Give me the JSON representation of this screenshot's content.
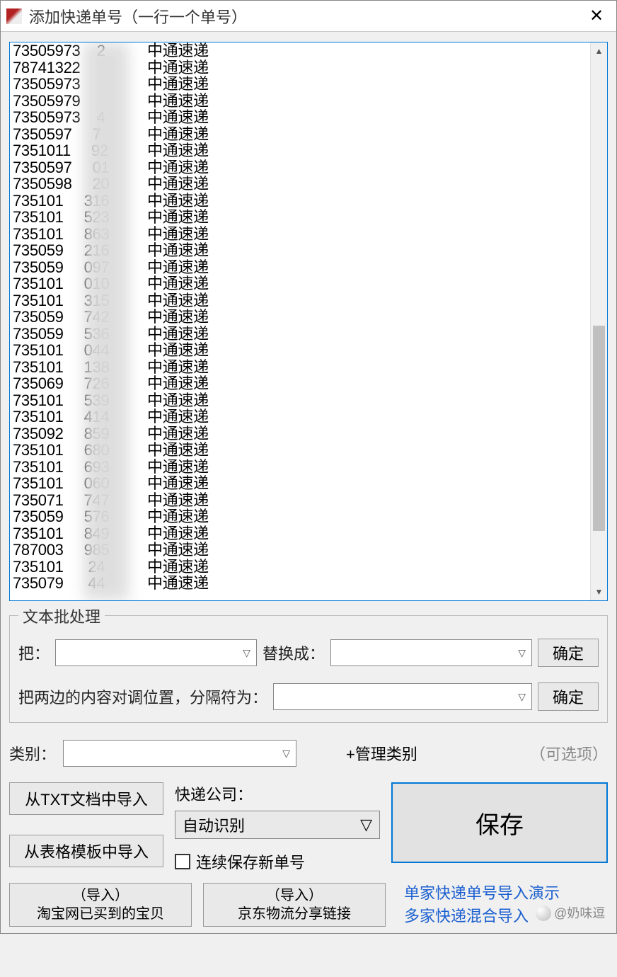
{
  "window": {
    "title": "添加快递单号（一行一个单号）"
  },
  "tracking_list": [
    {
      "num_left": "73505973",
      "num_right": "2",
      "carrier": "中通速递"
    },
    {
      "num_left": "78741322",
      "num_right": "",
      "carrier": "中通速递"
    },
    {
      "num_left": "73505973",
      "num_right": "",
      "carrier": "中通速递"
    },
    {
      "num_left": "73505979",
      "num_right": "",
      "carrier": "中通速递"
    },
    {
      "num_left": "73505973",
      "num_right": "4",
      "carrier": "中通速递"
    },
    {
      "num_left": "7350597",
      "num_right": "7",
      "carrier": "中通速递"
    },
    {
      "num_left": "7351011",
      "num_right": "92",
      "carrier": "中通速递"
    },
    {
      "num_left": "7350597",
      "num_right": "01",
      "carrier": "中通速递"
    },
    {
      "num_left": "7350598",
      "num_right": "20",
      "carrier": "中通速递"
    },
    {
      "num_left": "735101",
      "num_right": "316",
      "carrier": "中通速递"
    },
    {
      "num_left": "735101",
      "num_right": "523",
      "carrier": "中通速递"
    },
    {
      "num_left": "735101",
      "num_right": "863",
      "carrier": "中通速递"
    },
    {
      "num_left": "735059",
      "num_right": "216",
      "carrier": "中通速递"
    },
    {
      "num_left": "735059",
      "num_right": "097",
      "carrier": "中通速递"
    },
    {
      "num_left": "735101",
      "num_right": "010",
      "carrier": "中通速递"
    },
    {
      "num_left": "735101",
      "num_right": "315",
      "carrier": "中通速递"
    },
    {
      "num_left": "735059",
      "num_right": "742",
      "carrier": "中通速递"
    },
    {
      "num_left": "735059",
      "num_right": "536",
      "carrier": "中通速递"
    },
    {
      "num_left": "735101",
      "num_right": "044",
      "carrier": "中通速递"
    },
    {
      "num_left": "735101",
      "num_right": "138",
      "carrier": "中通速递"
    },
    {
      "num_left": "735069",
      "num_right": "726",
      "carrier": "中通速递"
    },
    {
      "num_left": "735101",
      "num_right": "539",
      "carrier": "中通速递"
    },
    {
      "num_left": "735101",
      "num_right": "414",
      "carrier": "中通速递"
    },
    {
      "num_left": "735092",
      "num_right": "859",
      "carrier": "中通速递"
    },
    {
      "num_left": "735101",
      "num_right": "680",
      "carrier": "中通速递"
    },
    {
      "num_left": "735101",
      "num_right": "693",
      "carrier": "中通速递"
    },
    {
      "num_left": "735101",
      "num_right": "060",
      "carrier": "中通速递"
    },
    {
      "num_left": "735071",
      "num_right": "747",
      "carrier": "中通速递"
    },
    {
      "num_left": "735059",
      "num_right": "576",
      "carrier": "中通速递"
    },
    {
      "num_left": "735101",
      "num_right": "849",
      "carrier": "中通速递"
    },
    {
      "num_left": "787003",
      "num_right": "985",
      "carrier": "中通速递"
    },
    {
      "num_left": "735101",
      "num_right": "24",
      "carrier": "中通速递"
    },
    {
      "num_left": "735079",
      "num_right": "44",
      "carrier": "中通速递"
    }
  ],
  "batch": {
    "group_label": "文本批处理",
    "replace_from_label": "把：",
    "replace_to_label": "替换成：",
    "ok_label": "确定",
    "swap_label": "把两边的内容对调位置，分隔符为："
  },
  "category": {
    "label": "类别：",
    "manage_link": "+管理类别",
    "optional": "（可选项）"
  },
  "import": {
    "from_txt": "从TXT文档中导入",
    "from_sheet": "从表格模板中导入"
  },
  "company": {
    "label": "快递公司：",
    "selected": "自动识别"
  },
  "checkbox": {
    "label": "连续保存新单号"
  },
  "save_label": "保存",
  "bottom_imports": {
    "taobao_line1": "（导入）",
    "taobao_line2": "淘宝网已买到的宝贝",
    "jd_line1": "（导入）",
    "jd_line2": "京东物流分享链接"
  },
  "links": {
    "demo_single": "单家快递单号导入演示",
    "demo_multi": "多家快递混合导入"
  },
  "watermark": "@奶味逗"
}
